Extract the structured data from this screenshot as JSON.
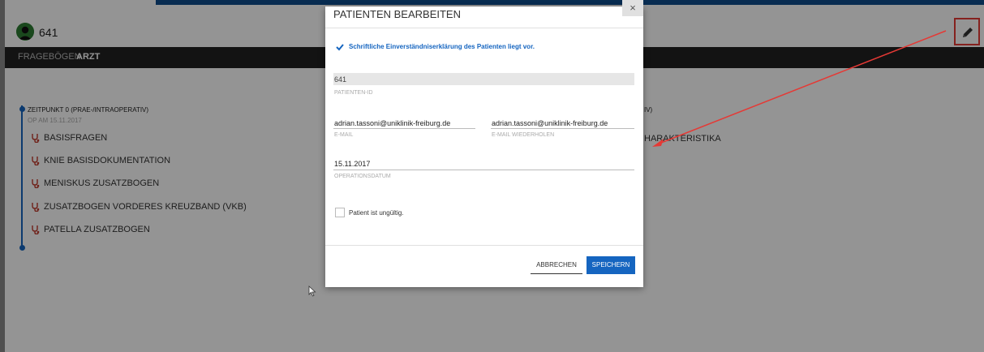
{
  "header": {
    "patient_id": "641"
  },
  "nav": {
    "items": [
      {
        "label": "FRAGEBÖGEN"
      },
      {
        "label": "ARZT"
      }
    ]
  },
  "timepoint": {
    "title": "ZEITPUNKT 0 (PRAE-/INTRAOPERATIV)",
    "subtitle": "OP AM 15.11.2017",
    "items": [
      {
        "label": "BASISFRAGEN"
      },
      {
        "label": "KNIE BASISDOKUMENTATION"
      },
      {
        "label": "MENISKUS ZUSATZBOGEN"
      },
      {
        "label": "ZUSATZBOGEN VORDERES KREUZBAND (VKB)"
      },
      {
        "label": "PATELLA ZUSATZBOGEN"
      }
    ],
    "right_title_fragment": "IV)",
    "right_item_fragment": "HARAKTERISTIKA"
  },
  "modal": {
    "title": "PATIENTEN BEARBEITEN",
    "close": "×",
    "consent_label": "Schriftliche Einverständniserklärung des Patienten liegt vor.",
    "consent_checked": true,
    "patient_id_value": "641",
    "patient_id_label": "PATIENTEN-ID",
    "email_value": "adrian.tassoni@uniklinik-freiburg.de",
    "email_label": "E-MAIL",
    "email_repeat_value": "adrian.tassoni@uniklinik-freiburg.de",
    "email_repeat_label": "E-MAIL WIEDERHOLEN",
    "op_date_value": "15.11.2017",
    "op_date_label": "OPERATIONSDATUM",
    "invalid_label": "Patient ist ungültig.",
    "invalid_checked": false,
    "cancel_label": "ABBRECHEN",
    "save_label": "SPEICHERN"
  },
  "colors": {
    "accent": "#1565c0",
    "annotation": "#e53935",
    "nav_bg": "#212121",
    "icon_red": "#c0392b"
  }
}
